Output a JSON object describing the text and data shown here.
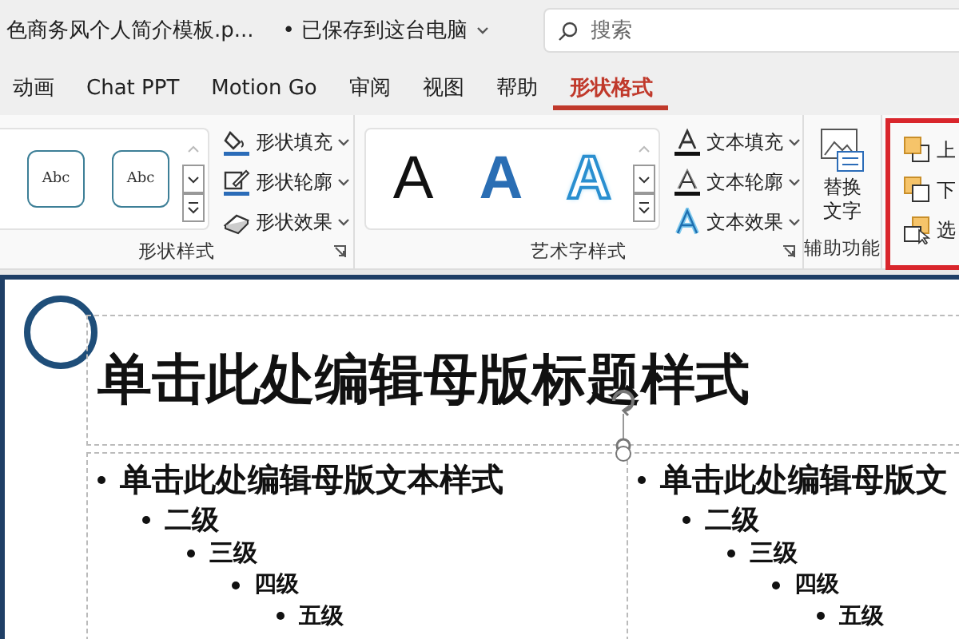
{
  "title_bar": {
    "file_name": "色商务风个人简介模板.p...",
    "save_status": "• 已保存到这台电脑",
    "search": {
      "placeholder": "搜索"
    }
  },
  "tabs": [
    {
      "label": "动画",
      "selected": false
    },
    {
      "label": "Chat PPT",
      "selected": false
    },
    {
      "label": "Motion Go",
      "selected": false
    },
    {
      "label": "审阅",
      "selected": false
    },
    {
      "label": "视图",
      "selected": false
    },
    {
      "label": "帮助",
      "selected": false
    },
    {
      "label": "形状格式",
      "selected": true
    }
  ],
  "ribbon": {
    "groups": [
      {
        "kind": "shape_styles",
        "label": "形状样式",
        "gallery": [
          {
            "text": "Abc"
          },
          {
            "text": "Abc"
          }
        ],
        "commands": [
          {
            "kind": "fill",
            "label": "形状填充"
          },
          {
            "kind": "outline",
            "label": "形状轮廓"
          },
          {
            "kind": "effects",
            "label": "形状效果"
          }
        ]
      },
      {
        "kind": "wordart",
        "label": "艺术字样式",
        "gallery": [
          {
            "text": "A"
          },
          {
            "text": "A"
          },
          {
            "text": "A"
          }
        ],
        "commands": [
          {
            "kind": "text-fill",
            "label": "文本填充"
          },
          {
            "kind": "text-outline",
            "label": "文本轮廓"
          },
          {
            "kind": "text-effects",
            "label": "文本效果"
          }
        ]
      },
      {
        "kind": "accessibility",
        "label": "辅助功能",
        "button": "替换文字"
      },
      {
        "kind": "arrange",
        "highlighted": true,
        "commands": [
          {
            "kind": "forward",
            "label": "上"
          },
          {
            "kind": "backward",
            "label": "下"
          },
          {
            "kind": "select",
            "label": "选"
          }
        ]
      }
    ]
  },
  "slide": {
    "title": "单击此处编辑母版标题样式",
    "content_columns": [
      {
        "items": [
          {
            "text": "单击此处编辑母版文本样式",
            "children": [
              {
                "text": "二级",
                "children": [
                  {
                    "text": "三级",
                    "children": [
                      {
                        "text": "四级",
                        "children": [
                          {
                            "text": "五级"
                          }
                        ]
                      }
                    ]
                  }
                ]
              }
            ]
          }
        ]
      },
      {
        "items": [
          {
            "text": "单击此处编辑母版文",
            "children": [
              {
                "text": "二级",
                "children": [
                  {
                    "text": "三级",
                    "children": [
                      {
                        "text": "四级",
                        "children": [
                          {
                            "text": "五级"
                          }
                        ]
                      }
                    ]
                  }
                ]
              }
            ]
          }
        ]
      }
    ]
  }
}
